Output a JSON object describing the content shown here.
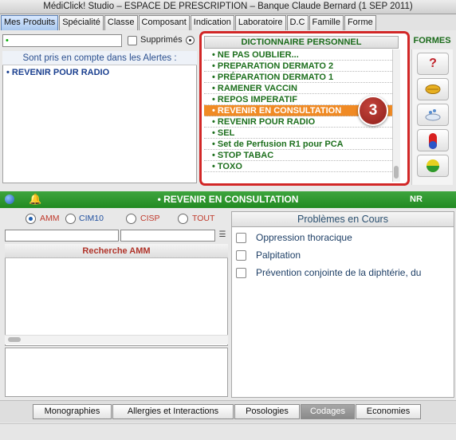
{
  "window": {
    "title": "MédiClick! Studio – ESPACE DE PRESCRIPTION – Banque Claude Bernard (1 SEP 2011)"
  },
  "tabs": [
    {
      "label": "Mes Produits",
      "active": true
    },
    {
      "label": "Spécialité",
      "active": false
    },
    {
      "label": "Classe",
      "active": false
    },
    {
      "label": "Composant",
      "active": false
    },
    {
      "label": "Indication",
      "active": false
    },
    {
      "label": "Laboratoire",
      "active": false
    },
    {
      "label": "D.C",
      "active": false
    },
    {
      "label": "Famille",
      "active": false
    },
    {
      "label": "Forme",
      "active": false
    }
  ],
  "filter": {
    "value": "•",
    "supprimes_label": "Supprimés"
  },
  "alerts": {
    "header": "Sont pris en compte dans les Alertes :",
    "items": [
      "• REVENIR POUR RADIO"
    ]
  },
  "dictionary": {
    "header": "DICTIONNAIRE PERSONNEL",
    "items": [
      "• NE PAS OUBLIER...",
      "• PREPARATION DERMATO 2",
      "• PRÉPARATION DERMATO 1",
      "• RAMENER VACCIN",
      "• REPOS IMPERATIF",
      "• REVENIR EN CONSULTATION",
      "• REVENIR POUR RADIO",
      "• SEL",
      "• Set de Perfusion R1 pour PCA",
      "• STOP TABAC",
      "• TOXO"
    ],
    "selected_index": 5,
    "badge": "3"
  },
  "formes": {
    "header": "FORMES",
    "icons": [
      "question-icon",
      "tablet-icon",
      "powder-icon",
      "capsule-icon",
      "pill-icon"
    ]
  },
  "banner": {
    "title": "• REVENIR EN CONSULTATION",
    "code": "NR"
  },
  "search": {
    "options": [
      {
        "label": "AMM",
        "selected": true,
        "color": "#c0392b"
      },
      {
        "label": "CIM10",
        "selected": false,
        "color": "#1f4f9f"
      },
      {
        "label": "CISP",
        "selected": false,
        "color": "#c0392b"
      },
      {
        "label": "TOUT",
        "selected": false,
        "color": "#c0392b"
      }
    ],
    "results_header": "Recherche AMM"
  },
  "problems": {
    "header": "Problèmes en Cours",
    "items": [
      "Oppression thoracique",
      "Palpitation",
      "Prévention conjointe de la diphtérie, du"
    ]
  },
  "bottom_tabs": [
    {
      "label": "Monographies",
      "active": false
    },
    {
      "label": "Allergies et Interactions",
      "active": false
    },
    {
      "label": "Posologies",
      "active": false
    },
    {
      "label": "Codages",
      "active": true
    },
    {
      "label": "Economies",
      "active": false
    }
  ],
  "colors": {
    "accent_green": "#2e9a2e",
    "selection": "#f08a24",
    "badge": "#a52a23"
  }
}
